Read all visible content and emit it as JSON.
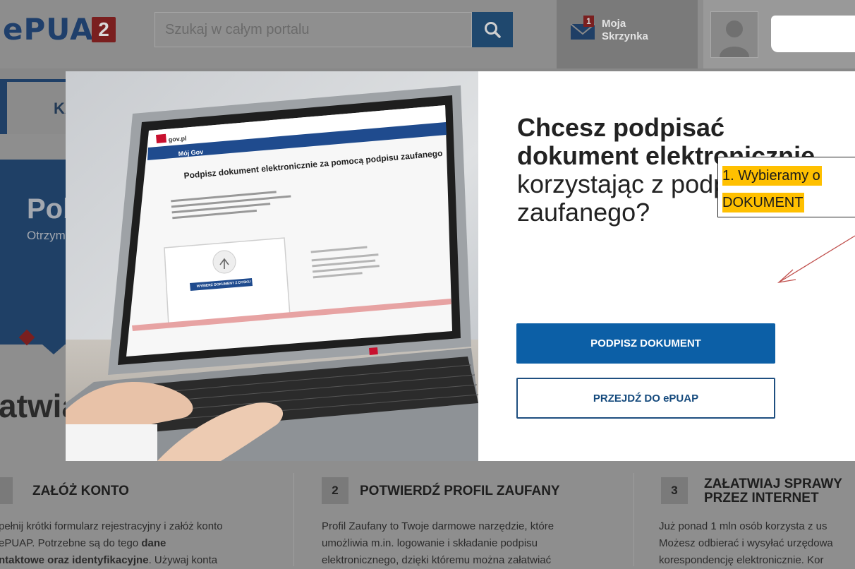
{
  "header": {
    "logo_text": "ePUAP",
    "logo_badge": "2",
    "search_placeholder": "Szukaj w całym portalu",
    "mailbox_badge": "1",
    "mailbox_label": "Moja\nSkrzynka"
  },
  "nav": {
    "active_tab_label": "KA"
  },
  "hero": {
    "title": "Pob",
    "subtitle": "Otrzym"
  },
  "section_heading": "atwia",
  "modal": {
    "title_bold": "Chcesz podpisać dokument elektronicznie",
    "title_rest": "korzystając z podpisu zaufanego?",
    "sign_button": "PODPISZ DOKUMENT",
    "epuap_button": "PRZEJDŹ DO ePUAP",
    "laptop_screen": {
      "brand": "gov.pl",
      "section": "Mój Gov",
      "heading": "Podpisz dokument elektronicznie za pomocą podpisu zaufanego",
      "upload_button": "WYBIERZ DOKUMENT Z DYSKU"
    }
  },
  "annotation": {
    "line1": "1. Wybieramy o",
    "line2": "DOKUMENT"
  },
  "steps": [
    {
      "number": "",
      "title": "ZAŁÓŻ KONTO",
      "text_a": "pełnij krótki formularz rejestracyjny i załóż konto",
      "text_b_plain": "ePUAP. Potrzebne są do tego ",
      "text_b_bold": "dane",
      "text_c_bold": "ntaktowe oraz identyfikacyjne",
      "text_c_plain": ". Używaj konta"
    },
    {
      "number": "2",
      "title": "POTWIERDŹ PROFIL ZAUFANY",
      "text_a": "Profil Zaufany to Twoje darmowe narzędzie, które",
      "text_b": "umożliwia m.in. logowanie i składanie podpisu",
      "text_c": "elektronicznego, dzięki któremu można załatwiać"
    },
    {
      "number": "3",
      "title": "ZAŁATWIAJ SPRAWY PRZEZ INTERNET",
      "text_a": "Już ponad 1 mln osób korzysta z us",
      "text_b": "Możesz odbierać i wysyłać urzędowa",
      "text_c": "korespondencję elektronicznie. Kor"
    }
  ],
  "colors": {
    "primary_button": "#0c5fa6",
    "callout_highlight": "#ffc000",
    "annotation_arrow": "#c0504d",
    "hero_navy": "#1f4066"
  }
}
